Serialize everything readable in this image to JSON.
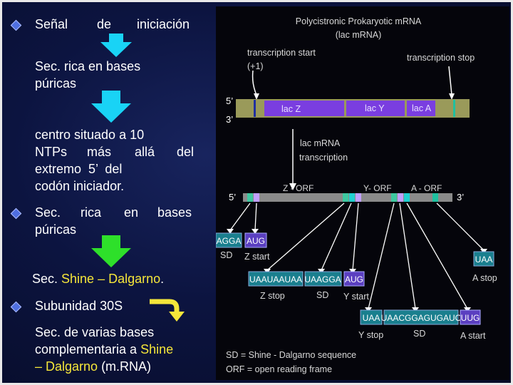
{
  "left": {
    "line1": {
      "word1": "Señal",
      "word2": "de",
      "word3": "iniciación"
    },
    "line2": "Sec. rica en bases",
    "line3": "púricas",
    "block": {
      "l1": "centro situado a 10",
      "l2a": "NTPs",
      "l2b": "más",
      "l2c": "allá",
      "l2d": "del",
      "l3": "extremo  5’  del",
      "l4": "codón iniciador."
    },
    "bullet2": {
      "a": "Sec.",
      "b": "rica",
      "c": "en",
      "d": "bases",
      "line2": "púricas"
    },
    "shine": {
      "prefix": "Sec. ",
      "highlight": "Shine – Dalgarno",
      "suffix": "."
    },
    "subunit": "Subunidad 30S",
    "final": {
      "l1": "Sec. de varias bases",
      "l2a": "complementaria a ",
      "l2b": "Shine",
      "l3a": "– Dalgarno",
      "l3b": " (m.RNA)"
    }
  },
  "diagram": {
    "title1": "Polycistronic Prokaryotic mRNA",
    "title2": "(lac mRNA)",
    "tx_start1": "transcription start",
    "tx_start2": "(+1)",
    "tx_stop": "transcription stop",
    "five_prime": "5’",
    "three_prime": "3’",
    "gene_z": "lac Z",
    "gene_y": "lac Y",
    "gene_a": "lac A",
    "mrna_label1": "lac mRNA",
    "mrna_label2": "transcription",
    "z_orf": "Z - ORF",
    "y_orf": "Y- ORF",
    "a_orf": "A - ORF",
    "agga": "AGGA",
    "aug1": "AUG",
    "sd1": "SD",
    "zstart": "Z start",
    "uaauaauaa": "UAAUAAUAA",
    "uaagga": "UAAGGA",
    "aug2": "AUG",
    "zstop": "Z stop",
    "sd2": "SD",
    "ystart": "Y start",
    "uaa1": "UAA",
    "astop": "A stop",
    "uaa2": "UAA",
    "uaacgg": "UAACGGAGUGAUC",
    "uug": "UUG",
    "ystop": "Y stop",
    "sd3": "SD",
    "astart": "A start",
    "legend1": "SD = Shine - Dalgarno sequence",
    "legend2": "ORF = open reading frame"
  },
  "colors": {
    "arrow_cyan": "#19d3f5",
    "arrow_green": "#2ee02a",
    "arrow_yellow": "#f5e63a",
    "gene_purple": "#7a3ee0",
    "box_teal": "#1a7f8e",
    "box_purple": "#5b3fc0"
  }
}
